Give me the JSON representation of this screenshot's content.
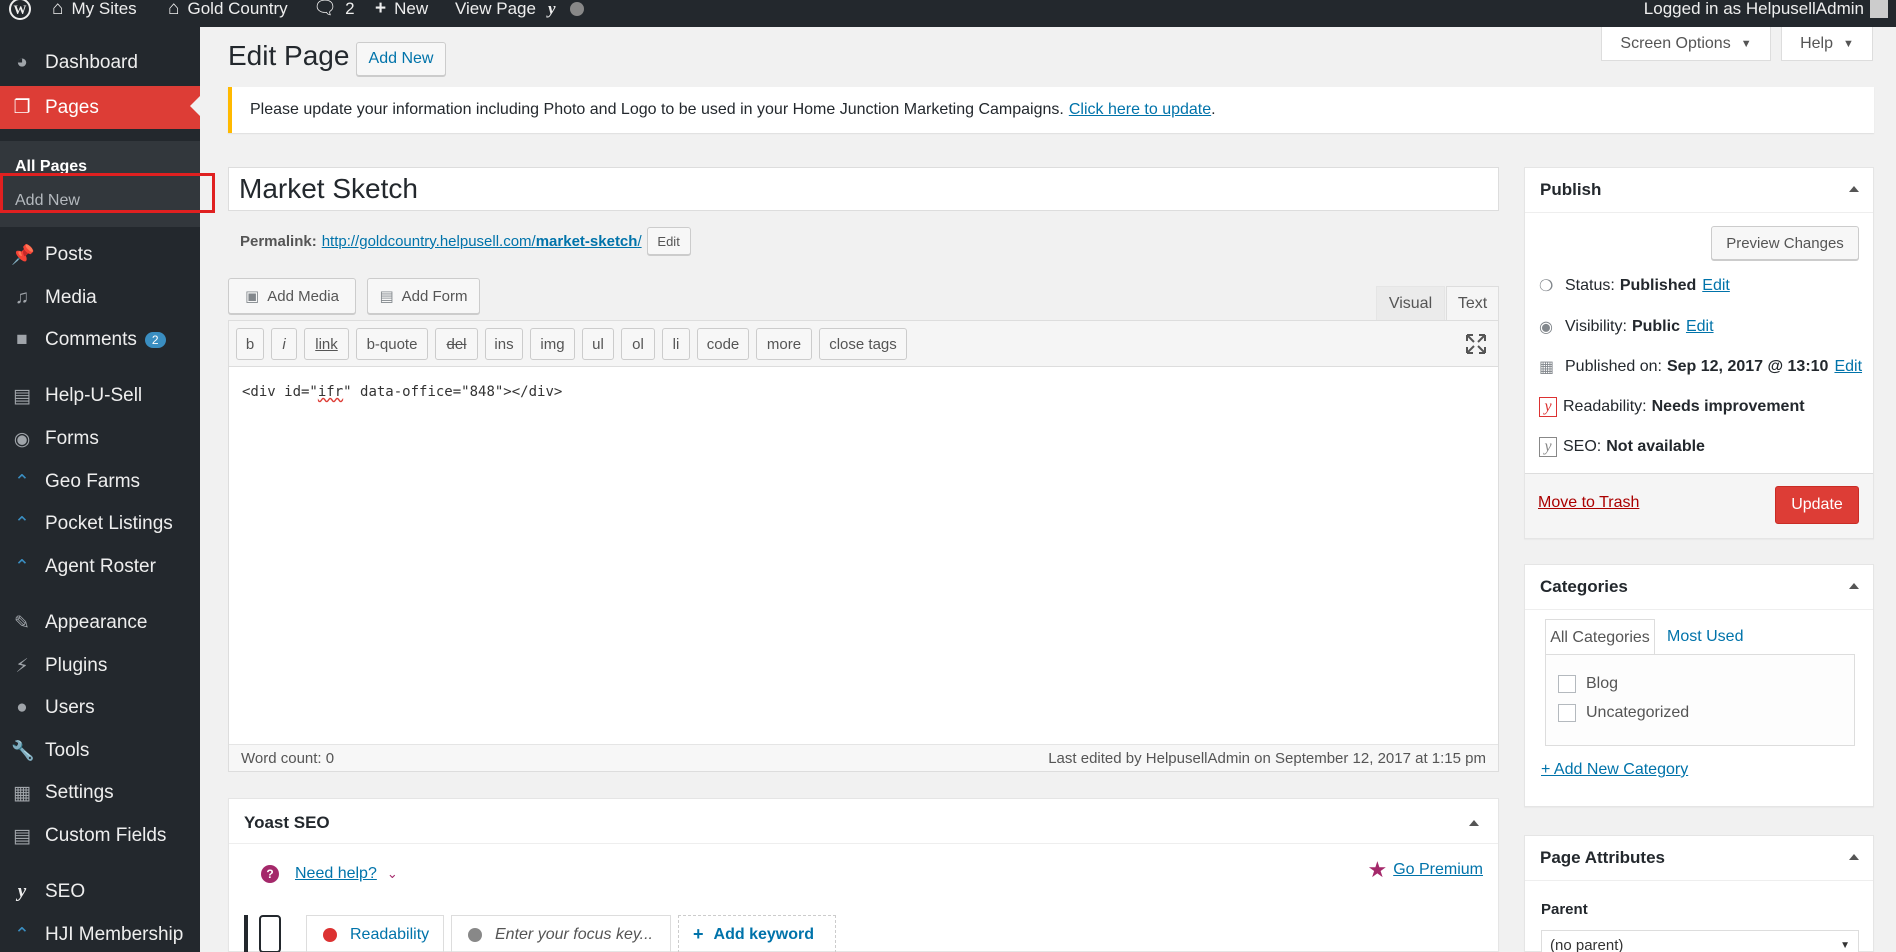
{
  "admin_bar": {
    "my_sites": "My Sites",
    "site_name": "Gold Country",
    "comments_count": "2",
    "new_label": "New",
    "view_page": "View Page",
    "logged_in": "Logged in as HelpusellAdmin"
  },
  "sidebar": {
    "items": [
      {
        "label": "Dashboard",
        "icon": "dashboard-icon"
      },
      {
        "label": "Pages",
        "icon": "pages-icon"
      },
      {
        "label": "Posts",
        "icon": "pin-icon"
      },
      {
        "label": "Media",
        "icon": "media-icon"
      },
      {
        "label": "Comments",
        "icon": "comment-icon",
        "badge": "2"
      },
      {
        "label": "Help-U-Sell",
        "icon": "helpusell-icon"
      },
      {
        "label": "Forms",
        "icon": "forms-icon"
      },
      {
        "label": "Geo Farms",
        "icon": "house-icon"
      },
      {
        "label": "Pocket Listings",
        "icon": "house-icon"
      },
      {
        "label": "Agent Roster",
        "icon": "house-icon"
      },
      {
        "label": "Appearance",
        "icon": "brush-icon"
      },
      {
        "label": "Plugins",
        "icon": "plugin-icon"
      },
      {
        "label": "Users",
        "icon": "user-icon"
      },
      {
        "label": "Tools",
        "icon": "wrench-icon"
      },
      {
        "label": "Settings",
        "icon": "settings-icon"
      },
      {
        "label": "Custom Fields",
        "icon": "fields-icon"
      },
      {
        "label": "SEO",
        "icon": "yoast-icon"
      },
      {
        "label": "HJI Membership",
        "icon": "house-icon"
      }
    ],
    "submenu": {
      "all_pages": "All Pages",
      "add_new": "Add New"
    }
  },
  "header": {
    "title": "Edit Page",
    "add_new": "Add New",
    "screen_options": "Screen Options",
    "help": "Help"
  },
  "notice": {
    "text": "Please update your information including Photo and Logo to be used in your Home Junction Marketing Campaigns.",
    "link": "Click here to update",
    "period": "."
  },
  "editor": {
    "post_title": "Market Sketch",
    "permalink_label": "Permalink:",
    "permalink_base": "http://goldcountry.helpusell.com/",
    "permalink_slug": "market-sketch",
    "permalink_end": "/",
    "permalink_edit": "Edit",
    "add_media": "Add Media",
    "add_form": "Add Form",
    "tab_visual": "Visual",
    "tab_text": "Text",
    "quicktags": [
      "b",
      "i",
      "link",
      "b-quote",
      "del",
      "ins",
      "img",
      "ul",
      "ol",
      "li",
      "code",
      "more",
      "close tags"
    ],
    "content_prefix": "<div id=\"",
    "content_id": "ifr",
    "content_suffix": "\" data-office=\"848\"></div>",
    "word_count": "Word count: 0",
    "last_edited": "Last edited by HelpusellAdmin on September 12, 2017 at 1:15 pm"
  },
  "yoast": {
    "title": "Yoast SEO",
    "need_help": "Need help?",
    "go_premium": "Go Premium",
    "tab_readability": "Readability",
    "focus_placeholder": "Enter your focus key...",
    "add_keyword": "Add keyword"
  },
  "publish": {
    "title": "Publish",
    "preview": "Preview Changes",
    "status_label": "Status:",
    "status_value": "Published",
    "visibility_label": "Visibility:",
    "visibility_value": "Public",
    "published_label": "Published on:",
    "published_value": "Sep 12, 2017 @ 13:10",
    "edit": "Edit",
    "readability_label": "Readability:",
    "readability_value": "Needs improvement",
    "seo_label": "SEO:",
    "seo_value": "Not available",
    "trash": "Move to Trash",
    "update": "Update"
  },
  "categories": {
    "title": "Categories",
    "tab_all": "All Categories",
    "tab_most_used": "Most Used",
    "items": [
      "Blog",
      "Uncategorized"
    ],
    "add_new": "+ Add New Category"
  },
  "page_attributes": {
    "title": "Page Attributes",
    "parent_label": "Parent",
    "parent_value": "(no parent)"
  },
  "colors": {
    "admin_bar": "#23282d",
    "active_menu": "#dd3d36",
    "link": "#0073aa",
    "update_button": "#d54e21",
    "notice_border": "#ffb900"
  }
}
